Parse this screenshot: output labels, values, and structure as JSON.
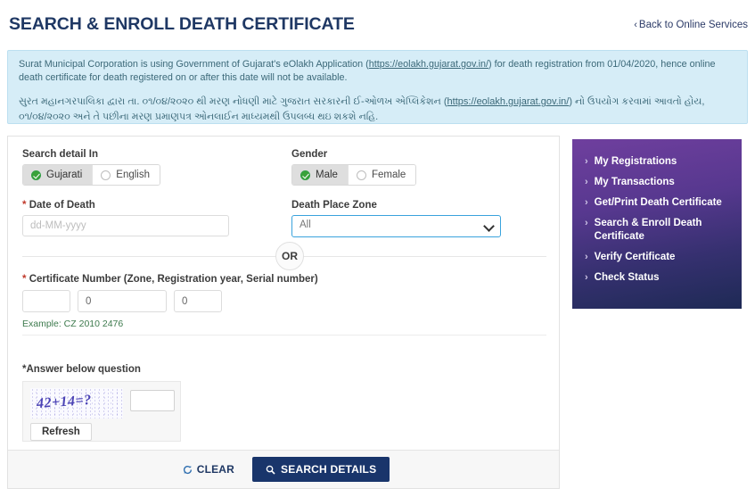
{
  "header": {
    "title": "SEARCH & ENROLL DEATH CERTIFICATE",
    "back_link": "Back to Online Services",
    "back_chevron": "‹"
  },
  "banner": {
    "english": "Surat Municipal Corporation is using Government of Gujarat's eOlakh Application (https://eolakh.gujarat.gov.in/) for death registration from 01/04/2020, hence online death certificate for death registered on or after this date will not be available.",
    "english_part1": "Surat Municipal Corporation is using Government of Gujarat's eOlakh Application (",
    "english_link": "https://eolakh.gujarat.gov.in/",
    "english_part2": ") for death registration from 01/04/2020, hence online death certificate for death registered on or after this date will not be available.",
    "gujarati_part1": "સુરત મહાનગરપાલિકા દ્વારા તા. ૦૧/૦૪/૨૦૨૦ થી મરણ નોધણી માટે ગુજરાત સરકારની ઈ-ઓળખ એપ્લિકેશન (",
    "gujarati_link": "https://eolakh.gujarat.gov.in/",
    "gujarati_part2": ") નો ઉપયોગ કરવામાં આવતો હોય, ૦૧/૦૪/૨૦૨૦ અને તે પછીના મરણ પ્રમાણપત્ર ઓનલાઈન માધ્યમથી ઉપલબ્ધ થઇ શકશે નહિ."
  },
  "form": {
    "search_detail_label": "Search detail In",
    "language_options": [
      {
        "label": "Gujarati",
        "selected": true
      },
      {
        "label": "English",
        "selected": false
      }
    ],
    "gender_label": "Gender",
    "gender_options": [
      {
        "label": "Male",
        "selected": true
      },
      {
        "label": "Female",
        "selected": false
      }
    ],
    "date_of_death_label": "Date of Death",
    "date_of_death_required": "*",
    "date_of_death_value": "",
    "date_of_death_placeholder": "dd-MM-yyyy",
    "death_place_zone_label": "Death Place Zone",
    "death_place_zone_value": "All",
    "or_text": "OR",
    "certificate_required": "*",
    "certificate_label": "Certificate Number (Zone, Registration year, Serial number)",
    "certificate_zone_value": "",
    "certificate_year_value": "0",
    "certificate_serial_value": "0",
    "certificate_example": "Example: CZ 2010 2476",
    "captcha_label": "*Answer below question",
    "captcha_question": "42+14=?",
    "captcha_answer_value": "",
    "refresh_label": "Refresh"
  },
  "footer": {
    "clear_label": "CLEAR",
    "search_label": "SEARCH DETAILS"
  },
  "sidebar": {
    "chevron": "›",
    "items": [
      {
        "label": "My Registrations"
      },
      {
        "label": "My Transactions"
      },
      {
        "label": "Get/Print Death Certificate"
      },
      {
        "label": "Search & Enroll Death Certificate"
      },
      {
        "label": "Verify Certificate"
      },
      {
        "label": "Check Status"
      }
    ]
  },
  "colors": {
    "title": "#1f3864",
    "banner_bg": "#d6edf7",
    "banner_text": "#3b6878",
    "primary_button": "#19356b",
    "sidebar_top": "#6f3f9e",
    "sidebar_bottom": "#1e2a55",
    "selected_radio": "#3aa23a",
    "example_text": "#3d7a4d",
    "required_star": "#c0392b"
  }
}
